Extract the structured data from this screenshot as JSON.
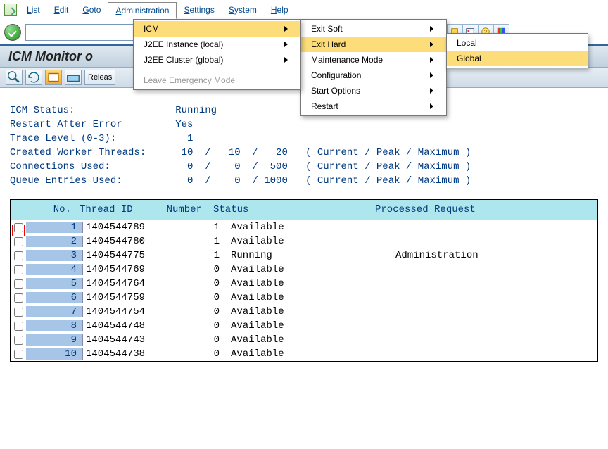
{
  "menubar": {
    "items": [
      "List",
      "Edit",
      "Goto",
      "Administration",
      "Settings",
      "System",
      "Help"
    ],
    "open_index": 3
  },
  "menu1": {
    "items": [
      {
        "label": "ICM",
        "arrow": true,
        "hover": true
      },
      {
        "label": "J2EE Instance (local)",
        "arrow": true
      },
      {
        "label": "J2EE Cluster (global)",
        "arrow": true
      },
      {
        "sep": true
      },
      {
        "label": "Leave Emergency Mode",
        "disabled": true
      }
    ]
  },
  "menu2": {
    "items": [
      {
        "label": "Exit Soft",
        "arrow": true
      },
      {
        "label": "Exit Hard",
        "arrow": true,
        "hover": true
      },
      {
        "label": "Maintenance Mode",
        "arrow": true
      },
      {
        "label": "Configuration",
        "arrow": true
      },
      {
        "label": "Start Options",
        "arrow": true
      },
      {
        "label": "Restart",
        "arrow": true
      }
    ]
  },
  "menu3": {
    "items": [
      {
        "label": "Local"
      },
      {
        "label": "Global",
        "hover": true
      }
    ]
  },
  "title": "ICM Monitor o",
  "app_toolbar": {
    "release_label": "Releas"
  },
  "status": {
    "lines": [
      "ICM Status:                 Running",
      "Restart After Error         Yes",
      "Trace Level (0-3):            1",
      "Created Worker Threads:      10  /   10  /   20   ( Current / Peak / Maximum )",
      "Connections Used:             0  /    0  /  500   ( Current / Peak / Maximum )",
      "Queue Entries Used:           0  /    0  / 1000   ( Current / Peak / Maximum )"
    ]
  },
  "grid": {
    "headers": {
      "no": "No.",
      "tid": "Thread ID",
      "num": "Number",
      "status": "Status",
      "pr": "Processed Request"
    },
    "rows": [
      {
        "no": 1,
        "tid": "1404544789",
        "num": 1,
        "status": "Available",
        "pr": ""
      },
      {
        "no": 2,
        "tid": "1404544780",
        "num": 1,
        "status": "Available",
        "pr": ""
      },
      {
        "no": 3,
        "tid": "1404544775",
        "num": 1,
        "status": "Running",
        "pr": "Administration"
      },
      {
        "no": 4,
        "tid": "1404544769",
        "num": 0,
        "status": "Available",
        "pr": ""
      },
      {
        "no": 5,
        "tid": "1404544764",
        "num": 0,
        "status": "Available",
        "pr": ""
      },
      {
        "no": 6,
        "tid": "1404544759",
        "num": 0,
        "status": "Available",
        "pr": ""
      },
      {
        "no": 7,
        "tid": "1404544754",
        "num": 0,
        "status": "Available",
        "pr": ""
      },
      {
        "no": 8,
        "tid": "1404544748",
        "num": 0,
        "status": "Available",
        "pr": ""
      },
      {
        "no": 9,
        "tid": "1404544743",
        "num": 0,
        "status": "Available",
        "pr": ""
      },
      {
        "no": 10,
        "tid": "1404544738",
        "num": 0,
        "status": "Available",
        "pr": ""
      }
    ]
  }
}
